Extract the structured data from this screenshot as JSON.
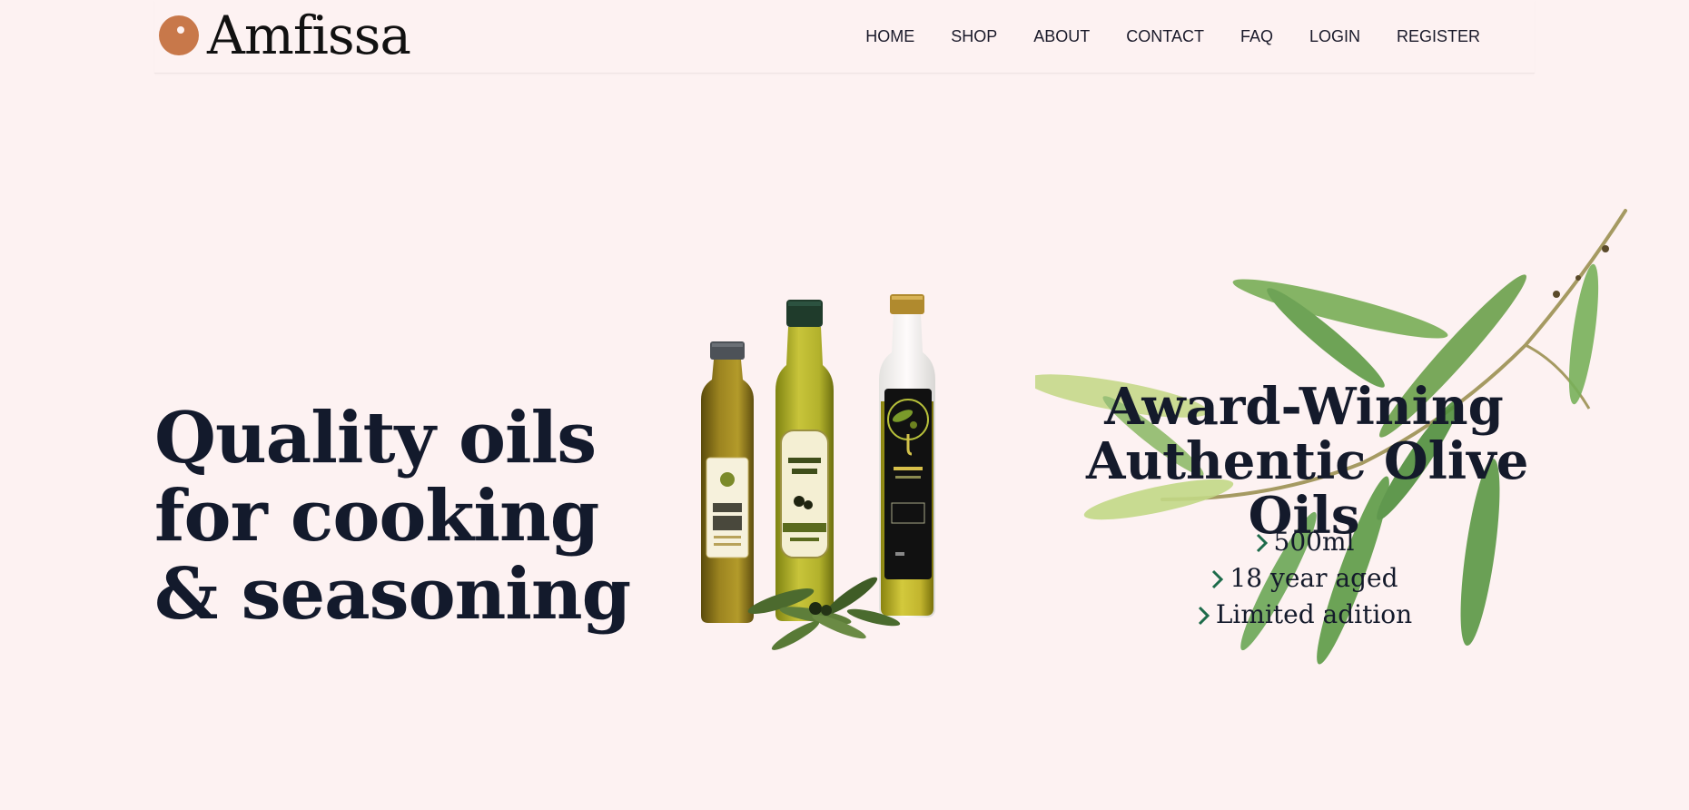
{
  "header": {
    "brand": "Amfissa",
    "nav": [
      "HOME",
      "SHOP",
      "ABOUT",
      "CONTACT",
      "FAQ",
      "LOGIN",
      "REGISTER"
    ]
  },
  "hero": {
    "title_lines": [
      "Quality oils",
      "for cooking",
      "& seasoning"
    ]
  },
  "product": {
    "heading_lines": [
      "Award-Wining",
      "Authentic Olive",
      "Oils"
    ],
    "features": [
      "500ml",
      "18 year aged",
      "Limited adition"
    ]
  },
  "colors": {
    "background": "#fdf2f2",
    "brand_accent": "#c8784a",
    "text": "#141a2b",
    "chevron": "#1d6b4a"
  },
  "icons": {
    "logo": "orange-circle-logo-icon",
    "feature_bullet": "chevron-right-icon"
  },
  "images": {
    "bottles": "olive-oil-bottles-image",
    "branch": "olive-branch-illustration"
  }
}
